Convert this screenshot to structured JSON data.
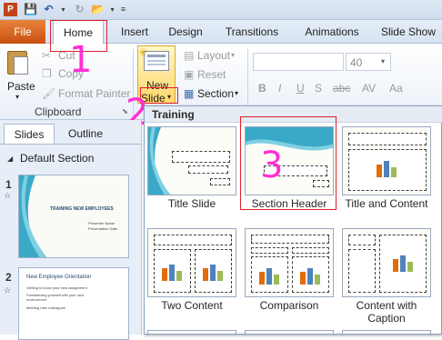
{
  "tabs": [
    "File",
    "Home",
    "Insert",
    "Design",
    "Transitions",
    "Animations",
    "Slide Show"
  ],
  "clipboard": {
    "paste_label": "Paste",
    "cut_label": "Cut",
    "copy_label": "Copy",
    "format_painter_label": "Format Painter",
    "group_label": "Clipboard"
  },
  "slides_group": {
    "new_slide_line1": "New",
    "new_slide_line2": "Slide",
    "layout_label": "Layout",
    "reset_label": "Reset",
    "section_label": "Section"
  },
  "font_size": "40",
  "format_buttons": [
    "B",
    "I",
    "U",
    "S",
    "abc",
    "AV",
    "Aa"
  ],
  "pane": {
    "tab_slides": "Slides",
    "tab_outline": "Outline",
    "section_name": "Default Section",
    "slides": [
      {
        "number": "1",
        "title": "TRAINING NEW EMPLOYEES",
        "sub1": "Presenter Name",
        "sub2": "Presentation Date"
      },
      {
        "number": "2",
        "title": "New Employee Orientation",
        "bullets": [
          "Getting to know your new assignment",
          "Familiarizing yourself with your new environment",
          "Meeting new colleagues"
        ]
      }
    ]
  },
  "gallery": {
    "header": "Training",
    "layouts": [
      "Title Slide",
      "Section Header",
      "Title and Content",
      "Two Content",
      "Comparison",
      "Content with Caption"
    ]
  },
  "annotations": [
    "1",
    "2",
    "3"
  ],
  "colors": {
    "accent": "#ff2fd4",
    "file_tab": "#d9641f",
    "highlight_box": "#e0202a"
  }
}
